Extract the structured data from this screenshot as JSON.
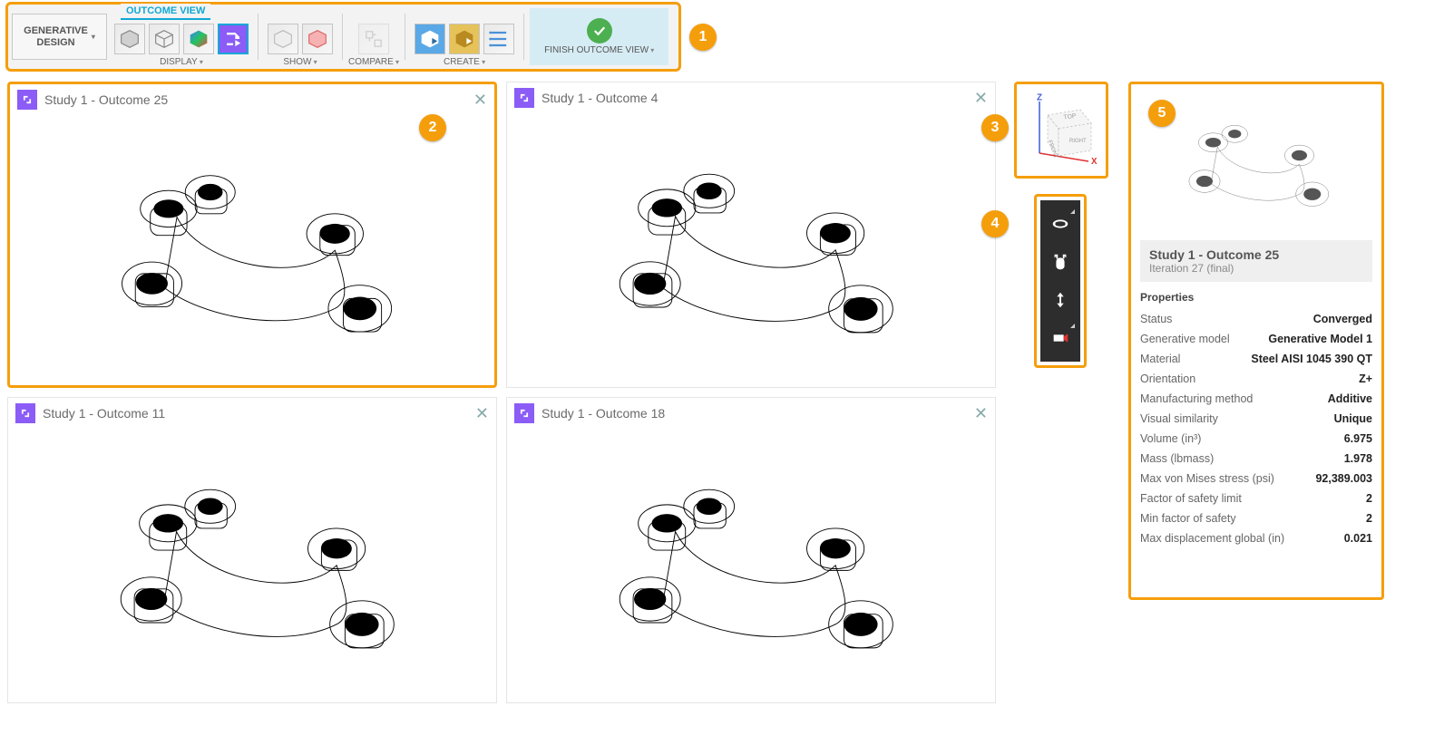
{
  "toolbar": {
    "tabLabel": "OUTCOME VIEW",
    "generativeDesignLabel": "GENERATIVE\nDESIGN",
    "groups": {
      "display": "DISPLAY",
      "show": "SHOW",
      "compare": "COMPARE",
      "create": "CREATE",
      "finish": "FINISH OUTCOME VIEW"
    }
  },
  "tiles": [
    {
      "title": "Study 1  - Outcome 25"
    },
    {
      "title": "Study 1 - Outcome 4"
    },
    {
      "title": "Study 1 - Outcome 11"
    },
    {
      "title": "Study 1 - Outcome 18"
    }
  ],
  "viewcube": {
    "axisZ": "Z",
    "axisX": "X",
    "faceTop": "TOP",
    "faceFront": "FRONT",
    "faceRight": "RIGHT"
  },
  "properties": {
    "title": "Study 1  - Outcome 25",
    "subtitle": "Iteration 27 (final)",
    "sectionHeader": "Properties",
    "rows": [
      {
        "label": "Status",
        "value": "Converged"
      },
      {
        "label": "Generative model",
        "value": "Generative Model 1"
      },
      {
        "label": "Material",
        "value": "Steel AISI 1045 390 QT"
      },
      {
        "label": "Orientation",
        "value": "Z+"
      },
      {
        "label": "Manufacturing method",
        "value": "Additive"
      },
      {
        "label": "Visual similarity",
        "value": "Unique"
      },
      {
        "label": "Volume (in³)",
        "value": "6.975"
      },
      {
        "label": "Mass (lbmass)",
        "value": "1.978"
      },
      {
        "label": "Max von Mises stress (psi)",
        "value": "92,389.003"
      },
      {
        "label": "Factor of safety limit",
        "value": "2"
      },
      {
        "label": "Min factor of safety",
        "value": "2"
      },
      {
        "label": "Max displacement global (in)",
        "value": "0.021"
      }
    ]
  },
  "callouts": [
    "1",
    "2",
    "3",
    "4",
    "5"
  ]
}
